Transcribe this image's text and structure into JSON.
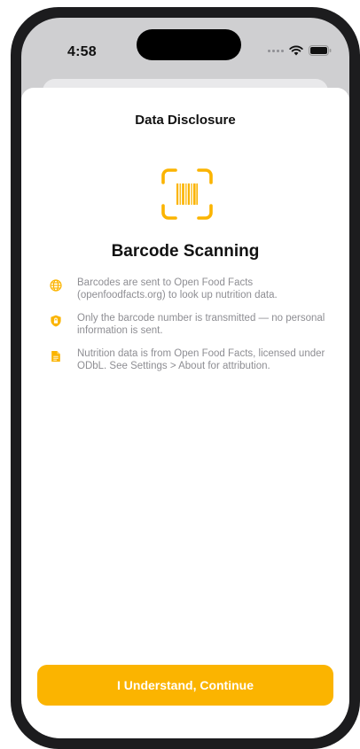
{
  "status_bar": {
    "time": "4:58"
  },
  "sheet": {
    "title": "Data Disclosure",
    "heading": "Barcode Scanning"
  },
  "items": [
    {
      "icon": "globe-icon",
      "text": "Barcodes are sent to Open Food Facts (openfoodfacts.org) to look up nutrition data."
    },
    {
      "icon": "lock-shield-icon",
      "text": "Only the barcode number is transmitted — no personal information is sent."
    },
    {
      "icon": "document-icon",
      "text": "Nutrition data is from Open Food Facts, licensed under ODbL. See Settings > About for attribution."
    }
  ],
  "button": {
    "label": "I Understand, Continue"
  },
  "colors": {
    "accent": "#fbb400",
    "secondary_text": "#8e8e93"
  }
}
